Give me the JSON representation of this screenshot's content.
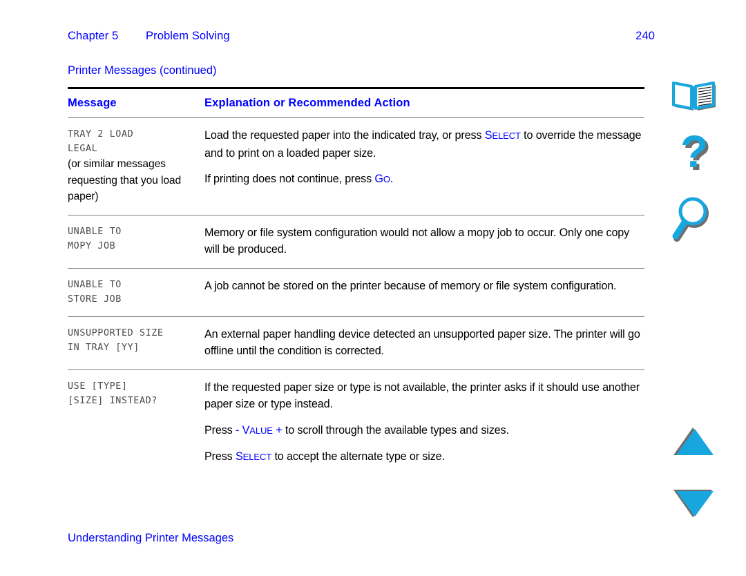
{
  "running_head": {
    "chapter_number": "Chapter 5",
    "chapter_title": "Problem Solving",
    "page_number": "240"
  },
  "table_caption": "Printer Messages (continued)",
  "table": {
    "headers": {
      "message": "Message",
      "explanation": "Explanation or Recommended Action"
    },
    "rows": [
      {
        "message_lcd": "TRAY 2 LOAD\nLEGAL",
        "message_note": "(or similar messages requesting that you load paper)",
        "paragraphs": [
          {
            "segments": [
              {
                "type": "text",
                "text": "Load the requested paper into the indicated tray, or press "
              },
              {
                "type": "key",
                "text": "SELECT"
              },
              {
                "type": "text",
                "text": " to override the message and to print on a loaded paper size."
              }
            ]
          },
          {
            "segments": [
              {
                "type": "text",
                "text": "If printing does not continue, press "
              },
              {
                "type": "key",
                "text": "GO"
              },
              {
                "type": "text",
                "text": "."
              }
            ]
          }
        ]
      },
      {
        "message_lcd": "UNABLE TO\nMOPY JOB",
        "message_note": "",
        "paragraphs": [
          {
            "segments": [
              {
                "type": "text",
                "text": "Memory or file system configuration would not allow a mopy job to occur. Only one copy will be produced."
              }
            ]
          }
        ]
      },
      {
        "message_lcd": "UNABLE TO\nSTORE JOB",
        "message_note": "",
        "paragraphs": [
          {
            "segments": [
              {
                "type": "text",
                "text": "A job cannot be stored on the printer because of memory or file system configuration."
              }
            ]
          }
        ]
      },
      {
        "message_lcd": "UNSUPPORTED SIZE\nIN TRAY [YY]",
        "message_note": "",
        "paragraphs": [
          {
            "segments": [
              {
                "type": "text",
                "text": "An external paper handling device detected an unsupported paper size. The printer will go offline until the condition is corrected."
              }
            ]
          }
        ]
      },
      {
        "message_lcd": "USE [TYPE]\n[SIZE] INSTEAD?",
        "message_note": "",
        "paragraphs": [
          {
            "segments": [
              {
                "type": "text",
                "text": "If the requested paper size or type is not available, the printer asks if it should use another paper size or type instead."
              }
            ]
          },
          {
            "segments": [
              {
                "type": "text",
                "text": "Press "
              },
              {
                "type": "symbol",
                "text": "-"
              },
              {
                "type": "text",
                "text": " "
              },
              {
                "type": "key",
                "text": "VALUE"
              },
              {
                "type": "text",
                "text": " "
              },
              {
                "type": "symbol",
                "text": "+"
              },
              {
                "type": "text",
                "text": " to scroll through the available types and sizes."
              }
            ]
          },
          {
            "segments": [
              {
                "type": "text",
                "text": "Press "
              },
              {
                "type": "key",
                "text": "SELECT"
              },
              {
                "type": "text",
                "text": " to accept the alternate type or size."
              }
            ]
          }
        ]
      }
    ]
  },
  "footer": "Understanding Printer Messages",
  "nav_icons": [
    {
      "name": "contents-book-icon",
      "label": "Contents"
    },
    {
      "name": "help-question-icon",
      "label": "Help"
    },
    {
      "name": "search-magnifier-icon",
      "label": "Search"
    },
    {
      "name": "previous-page-up-arrow-icon",
      "label": "Previous page"
    },
    {
      "name": "next-page-down-arrow-icon",
      "label": "Next page"
    }
  ],
  "colors": {
    "link_blue": "#0000ff",
    "icon_cyan": "#18a6de",
    "icon_shadow": "#6e6e6e",
    "rule_dark": "#000000",
    "rule_light": "#7d7d7d",
    "lcd_text": "#4a4a4a"
  }
}
